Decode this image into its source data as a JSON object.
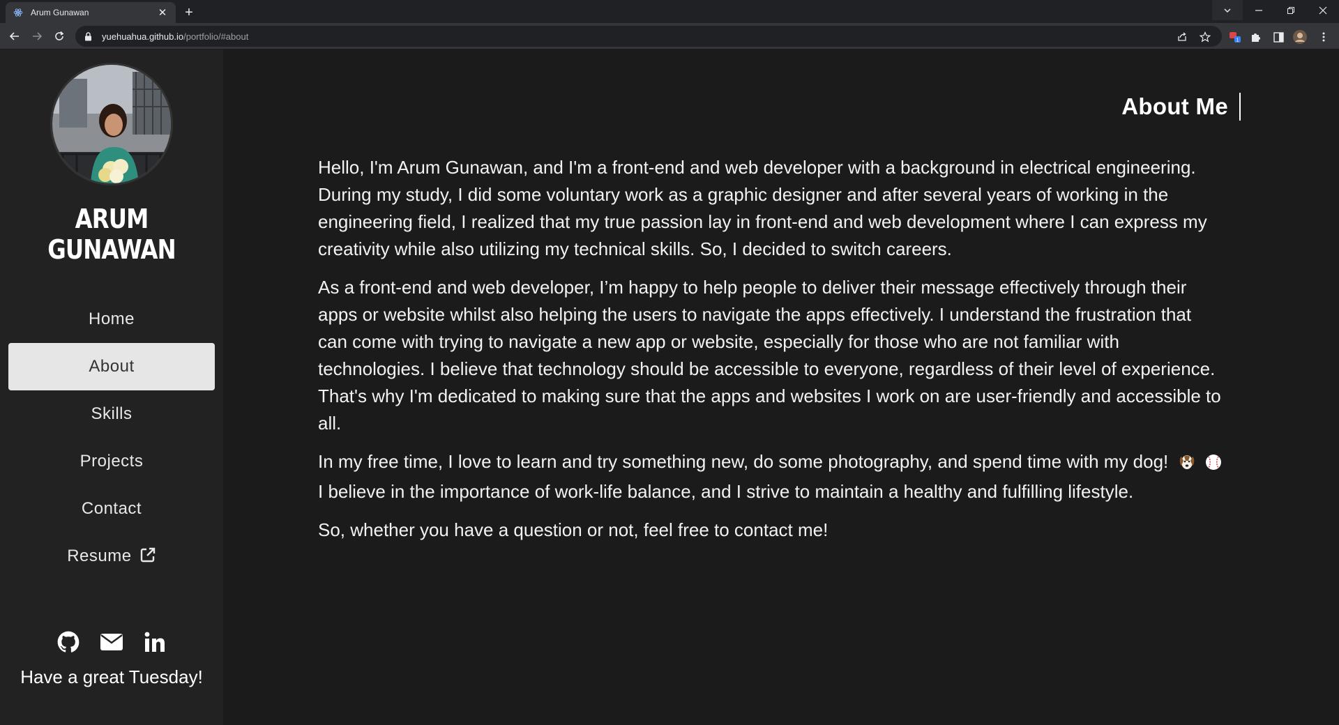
{
  "browser": {
    "tab_title": "Arum Gunawan",
    "url_host": "yuehuahua.github.io",
    "url_path": "/portfolio/#about"
  },
  "sidebar": {
    "name": "ARUM GUNAWAN",
    "nav": [
      {
        "label": "Home"
      },
      {
        "label": "About"
      },
      {
        "label": "Skills"
      },
      {
        "label": "Projects"
      },
      {
        "label": "Contact"
      },
      {
        "label": "Resume"
      }
    ],
    "active_nav": "About",
    "greeting": "Have a great Tuesday!"
  },
  "main": {
    "title": "About Me",
    "paragraphs": [
      "Hello, I'm Arum Gunawan, and I'm a front-end and web developer with a background in electrical engineering. During my study, I did some voluntary work as a graphic designer and after several years of working in the engineering field, I realized that my true passion lay in front-end and web development where I can express my creativity while also utilizing my technical skills. So, I decided to switch careers.",
      "As a front-end and web developer, I’m happy to help people to deliver their message effectively through their apps or website whilst also helping the users to navigate the apps effectively. I understand the frustration that can come with trying to navigate a new app or website, especially for those who are not familiar with technologies. I believe that technology should be accessible to everyone, regardless of their level of experience. That's why I'm dedicated to making sure that the apps and websites I work on are user-friendly and accessible to all.",
      "In my free time, I love to learn and try something new, do some photography, and spend time with my dog!",
      "I believe in the importance of work-life balance, and I strive to maintain a healthy and fulfilling lifestyle.",
      "So, whether you have a question or not, feel free to contact me!"
    ]
  },
  "icons": {
    "social": [
      "github-icon",
      "mail-icon",
      "linkedin-icon"
    ],
    "emoji": [
      "dog-face",
      "baseball"
    ]
  },
  "colors": {
    "sidebar_bg": "#222222",
    "main_bg": "#1b1b1b",
    "active_nav_bg": "#e6e6e6",
    "text": "#ffffff"
  }
}
